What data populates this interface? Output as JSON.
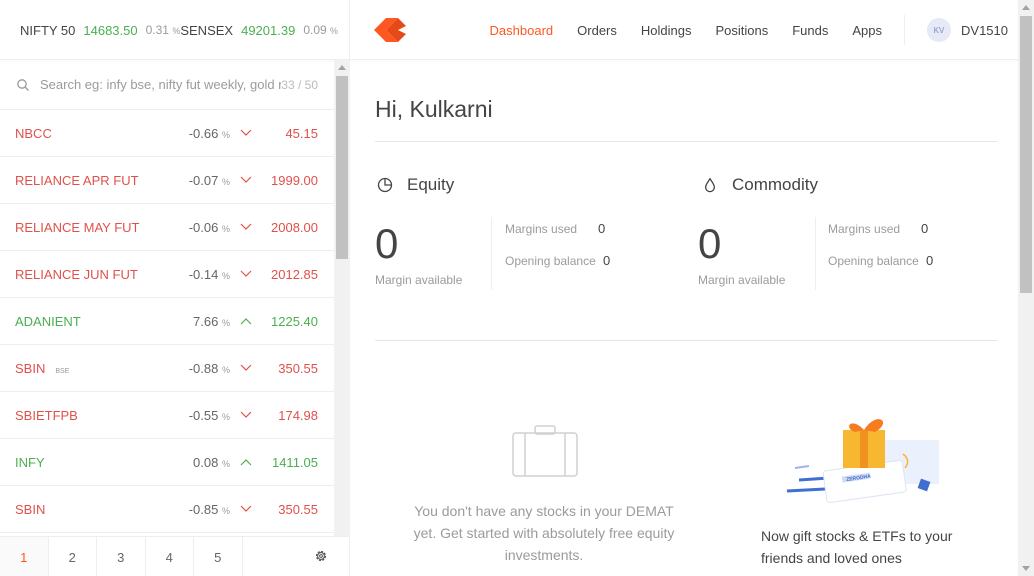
{
  "indices": [
    {
      "name": "NIFTY 50",
      "value": "14683.50",
      "change": "0.31",
      "pct": "%"
    },
    {
      "name": "SENSEX",
      "value": "49201.39",
      "change": "0.09",
      "pct": "%"
    }
  ],
  "nav": {
    "items": [
      "Dashboard",
      "Orders",
      "Holdings",
      "Positions",
      "Funds",
      "Apps"
    ],
    "active": "Dashboard",
    "avatar_initials": "KV",
    "user_id": "DV1510"
  },
  "search": {
    "placeholder": "Search eg: infy bse, nifty fut weekly, gold mcx",
    "count": "33 / 50"
  },
  "watchlist": [
    {
      "symbol": "NBCC",
      "exchange": "",
      "change": "-0.66",
      "direction": "down",
      "price": "45.15"
    },
    {
      "symbol": "RELIANCE APR FUT",
      "exchange": "",
      "change": "-0.07",
      "direction": "down",
      "price": "1999.00"
    },
    {
      "symbol": "RELIANCE MAY FUT",
      "exchange": "",
      "change": "-0.06",
      "direction": "down",
      "price": "2008.00"
    },
    {
      "symbol": "RELIANCE JUN FUT",
      "exchange": "",
      "change": "-0.14",
      "direction": "down",
      "price": "2012.85"
    },
    {
      "symbol": "ADANIENT",
      "exchange": "",
      "change": "7.66",
      "direction": "up",
      "price": "1225.40"
    },
    {
      "symbol": "SBIN",
      "exchange": "BSE",
      "change": "-0.88",
      "direction": "down",
      "price": "350.55"
    },
    {
      "symbol": "SBIETFPB",
      "exchange": "",
      "change": "-0.55",
      "direction": "down",
      "price": "174.98"
    },
    {
      "symbol": "INFY",
      "exchange": "",
      "change": "0.08",
      "direction": "up",
      "price": "1411.05"
    },
    {
      "symbol": "SBIN",
      "exchange": "",
      "change": "-0.85",
      "direction": "down",
      "price": "350.55"
    }
  ],
  "pct_symbol": "%",
  "pages": [
    "1",
    "2",
    "3",
    "4",
    "5"
  ],
  "active_page": "1",
  "dashboard": {
    "greeting": "Hi, Kulkarni",
    "equity": {
      "title": "Equity",
      "margin_available": "0",
      "margin_available_label": "Margin available",
      "margins_used_label": "Margins used",
      "margins_used": "0",
      "opening_balance_label": "Opening balance",
      "opening_balance": "0"
    },
    "commodity": {
      "title": "Commodity",
      "margin_available": "0",
      "margin_available_label": "Margin available",
      "margins_used_label": "Margins used",
      "margins_used": "0",
      "opening_balance_label": "Opening balance",
      "opening_balance": "0"
    },
    "empty_holdings_message": "You don't have any stocks in your DEMAT yet. Get started with absolutely free equity investments.",
    "gift_message": "Now gift stocks & ETFs to your friends and loved ones",
    "gift_card_brand": "ZERODHA"
  },
  "colors": {
    "accent": "#ff5722",
    "up": "#4caf50",
    "down": "#df514c"
  }
}
